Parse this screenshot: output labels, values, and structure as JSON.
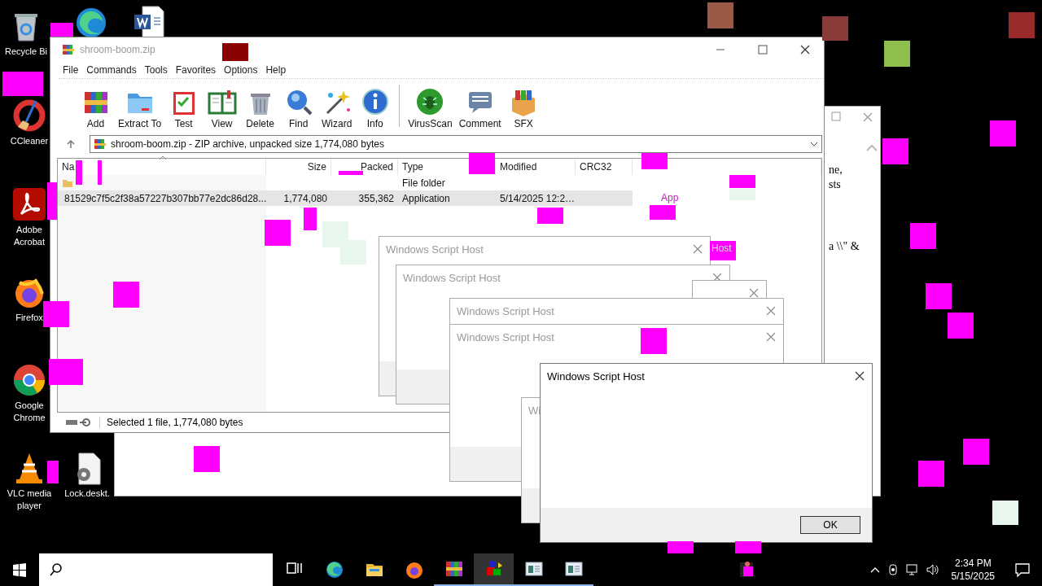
{
  "desktop_icons": [
    {
      "kind": "recycle-bin",
      "label": "Recycle Bi"
    },
    {
      "kind": "edge"
    },
    {
      "kind": "word-doc"
    },
    {
      "kind": "ccleaner",
      "label": "CCleaner"
    },
    {
      "kind": "acrobat",
      "label": "Adobe Acrobat"
    },
    {
      "kind": "firefox",
      "label": "Firefox"
    },
    {
      "kind": "chrome",
      "label": "Google Chrome"
    },
    {
      "kind": "vlc",
      "label": "VLC media player"
    },
    {
      "kind": "settings-file",
      "label": "Lock.deskt."
    }
  ],
  "background_window": {
    "fragments": [
      "ne,",
      "sts",
      "a \\\\\" &"
    ]
  },
  "winrar": {
    "title": "shroom-boom.zip",
    "menu": [
      "File",
      "Commands",
      "Tools",
      "Favorites",
      "Options",
      "Help"
    ],
    "toolbar": [
      {
        "kind": "books",
        "label": "Add"
      },
      {
        "kind": "folder",
        "label": "Extract To"
      },
      {
        "kind": "clipboard",
        "label": "Test"
      },
      {
        "kind": "book",
        "label": "View"
      },
      {
        "kind": "trash",
        "label": "Delete"
      },
      {
        "kind": "magnifier",
        "label": "Find"
      },
      {
        "kind": "wand",
        "label": "Wizard"
      },
      {
        "kind": "info",
        "label": "Info"
      },
      {
        "kind": "bug",
        "label": "VirusScan"
      },
      {
        "kind": "speech",
        "label": "Comment"
      },
      {
        "kind": "box",
        "label": "SFX"
      }
    ],
    "address": "shroom-boom.zip - ZIP archive, unpacked size 1,774,080 bytes",
    "columns": [
      "Na",
      "Size",
      "Packed",
      "Type",
      "Modified",
      "CRC32"
    ],
    "rows": [
      {
        "kind": "folder",
        "name": "",
        "size": "",
        "packed": "",
        "type": "File folder",
        "modified": "",
        "selected": false
      },
      {
        "kind": "file",
        "name": "81529c7f5c2f38a57227b307bb77e2dc86d28...",
        "size": "1,774,080",
        "packed": "355,362",
        "type": "Application",
        "modified": "5/14/2025 12:2…",
        "selected": true
      }
    ],
    "status": "Selected 1 file, 1,774,080 bytes"
  },
  "fragments": [
    "Host",
    "App"
  ],
  "dialogs": [
    {
      "title": "Windows Script Host",
      "active": false
    },
    {
      "title": "Windows Script Host",
      "active": false
    },
    {
      "active": false
    },
    {
      "title": "Windows Script Host",
      "active": false
    },
    {
      "title": "Windows Script Host",
      "active": false
    },
    {
      "title": "Wi",
      "active": false
    },
    {
      "title": "Windows Script Host",
      "active": true,
      "button": "OK"
    }
  ],
  "taskbar": {
    "items": [
      {
        "kind": "task-view",
        "active": false,
        "running": false
      },
      {
        "kind": "edge",
        "active": false,
        "running": false
      },
      {
        "kind": "explorer",
        "active": false,
        "running": false
      },
      {
        "kind": "firefox",
        "active": false,
        "running": false
      },
      {
        "kind": "winrar",
        "active": false,
        "running": true
      },
      {
        "kind": "shapes",
        "active": true,
        "running": true
      },
      {
        "kind": "script",
        "active": false,
        "running": true
      },
      {
        "kind": "script",
        "active": false,
        "running": true
      },
      {
        "kind": "glitch-app",
        "active": false,
        "running": false
      }
    ],
    "time": "2:34 PM",
    "date": "5/15/2025"
  }
}
